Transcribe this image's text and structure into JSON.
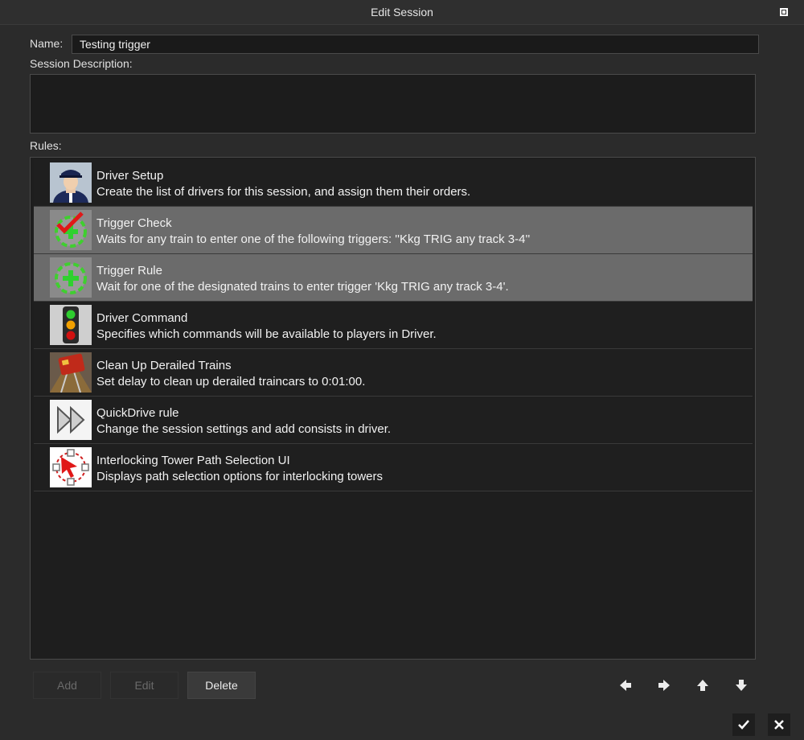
{
  "window": {
    "title": "Edit Session"
  },
  "form": {
    "name_label": "Name:",
    "name_value": "Testing trigger",
    "description_label": "Session Description:",
    "description_value": "",
    "rules_label": "Rules:"
  },
  "rules": [
    {
      "title": "Driver Setup",
      "description": "Create the list of drivers for this session, and assign them their orders.",
      "icon": "driver-icon",
      "selected": false
    },
    {
      "title": "Trigger Check",
      "description": "Waits for any train to enter one of the following triggers: ''Kkg TRIG any track 3-4''",
      "icon": "trigger-check-icon",
      "selected": true
    },
    {
      "title": "Trigger Rule",
      "description": "Wait for one of the designated trains to enter trigger 'Kkg TRIG any track 3-4'.",
      "icon": "trigger-rule-icon",
      "selected": true
    },
    {
      "title": "Driver Command",
      "description": "Specifies which commands will be available to players in Driver.",
      "icon": "traffic-light-icon",
      "selected": false
    },
    {
      "title": "Clean Up Derailed Trains",
      "description": "Set delay to clean up derailed traincars to 0:01:00.",
      "icon": "derailed-train-icon",
      "selected": false
    },
    {
      "title": "QuickDrive rule",
      "description": "Change the session settings and add consists in driver.",
      "icon": "fast-forward-icon",
      "selected": false
    },
    {
      "title": "Interlocking Tower Path Selection UI",
      "description": "Displays path selection options for interlocking towers",
      "icon": "path-selection-icon",
      "selected": false
    }
  ],
  "buttons": {
    "add": "Add",
    "edit": "Edit",
    "delete": "Delete"
  },
  "colors": {
    "selected_row": "#6b6b6b",
    "background": "#2b2b2b",
    "list_bg": "#1e1e1e"
  }
}
